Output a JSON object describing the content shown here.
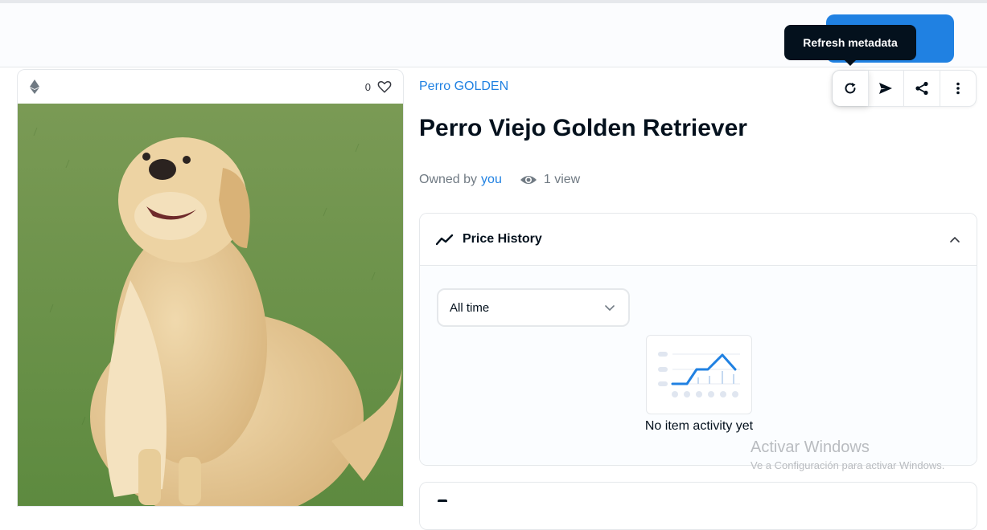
{
  "header": {
    "tooltip": "Refresh metadata",
    "accent_color": "#2081e2"
  },
  "image_card": {
    "chain_icon": "ethereum-icon",
    "favorite_count": "0",
    "favorite_icon": "heart-icon",
    "image_alt": "golden-retriever-dog-photo"
  },
  "item": {
    "collection": "Perro GOLDEN",
    "title": "Perro Viejo Golden Retriever",
    "owned_by_label": "Owned by",
    "owner": "you",
    "views": "1 view"
  },
  "actions": [
    {
      "name": "refresh-metadata-button",
      "icon": "refresh-icon"
    },
    {
      "name": "transfer-button",
      "icon": "send-icon"
    },
    {
      "name": "share-button",
      "icon": "share-icon"
    },
    {
      "name": "more-options-button",
      "icon": "more-vertical-icon"
    }
  ],
  "price_history": {
    "title": "Price History",
    "filter_value": "All time",
    "empty_message": "No item activity yet"
  },
  "watermark": {
    "title": "Activar Windows",
    "subtitle": "Ve a Configuración para activar Windows."
  }
}
